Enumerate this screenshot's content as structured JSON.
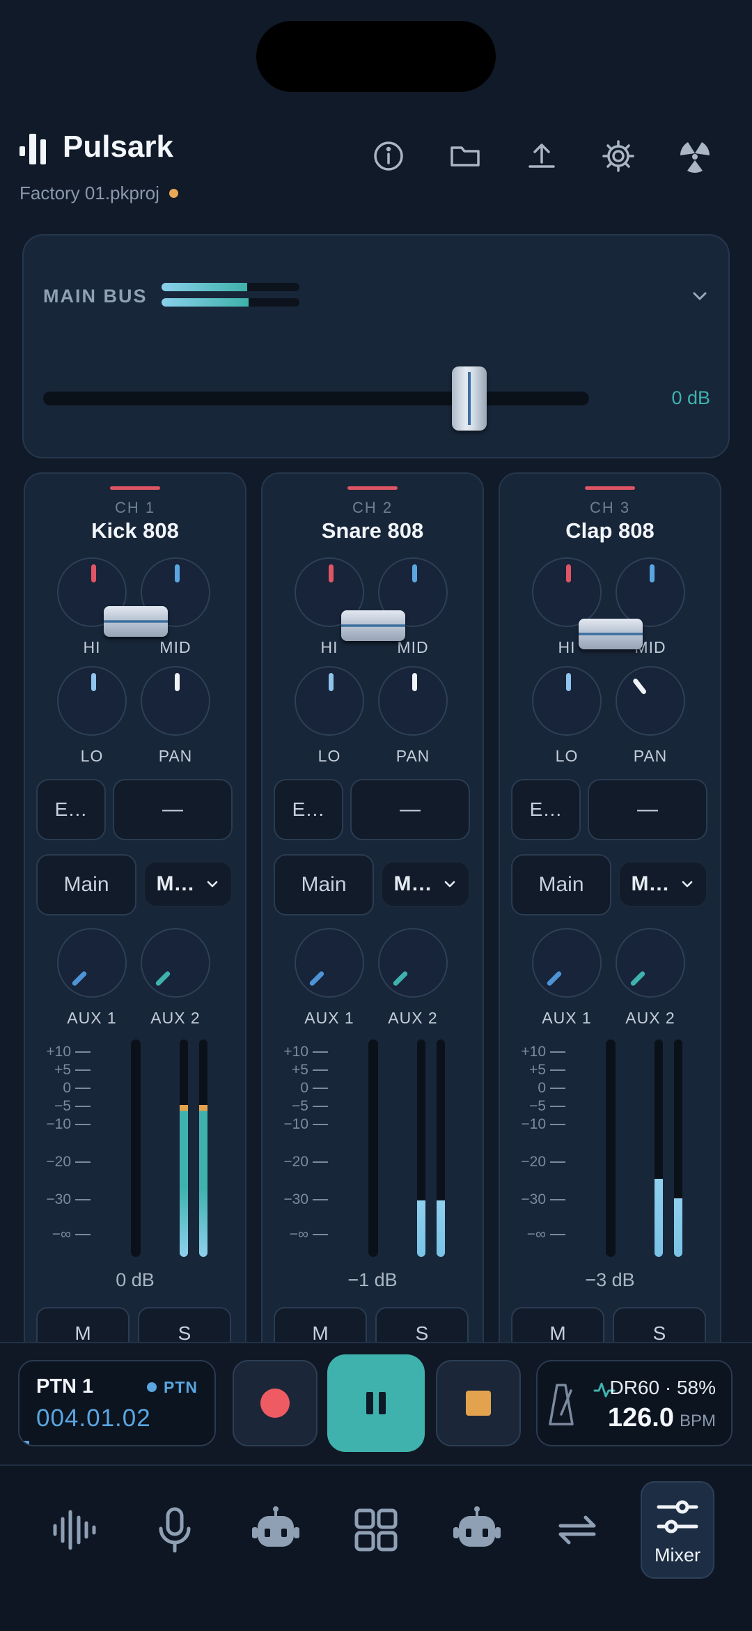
{
  "app": {
    "title": "Pulsark",
    "project": "Factory 01.pkproj"
  },
  "header_icons": [
    "info-icon",
    "folder-icon",
    "upload-icon",
    "gear-icon",
    "radiation-icon"
  ],
  "main_bus": {
    "label": "MAIN BUS",
    "level_l": 0.62,
    "level_r": 0.63,
    "fader_position": 0.78,
    "value": "0 dB"
  },
  "scale_labels": [
    "+10",
    "+5",
    "0",
    "−5",
    "−10",
    "−20",
    "−30",
    "−∞"
  ],
  "channels": [
    {
      "num": "CH 1",
      "name": "Kick 808",
      "knob_labels": [
        "HI",
        "MID",
        "LO",
        "PAN"
      ],
      "fx_button": "E…",
      "dash_button": "—",
      "route_button": "Main",
      "route_select": "M…",
      "aux_labels": [
        "AUX 1",
        "AUX 2"
      ],
      "fader_db": "0 dB",
      "mute": "M",
      "solo": "S",
      "meter_l": 0.7,
      "meter_r": 0.7
    },
    {
      "num": "CH 2",
      "name": "Snare 808",
      "knob_labels": [
        "HI",
        "MID",
        "LO",
        "PAN"
      ],
      "fx_button": "E…",
      "dash_button": "—",
      "route_button": "Main",
      "route_select": "M…",
      "aux_labels": [
        "AUX 1",
        "AUX 2"
      ],
      "fader_db": "−1 dB",
      "mute": "M",
      "solo": "S",
      "meter_l": 0.26,
      "meter_r": 0.26
    },
    {
      "num": "CH 3",
      "name": "Clap 808",
      "knob_labels": [
        "HI",
        "MID",
        "LO",
        "PAN"
      ],
      "fx_button": "E…",
      "dash_button": "—",
      "route_button": "Main",
      "route_select": "M…",
      "aux_labels": [
        "AUX 1",
        "AUX 2"
      ],
      "fader_db": "−3 dB",
      "mute": "M",
      "solo": "S",
      "meter_l": 0.36,
      "meter_r": 0.27
    }
  ],
  "transport": {
    "pattern": "PTN 1",
    "mode": "PTN",
    "position": "004.01.02",
    "progress": 0.05,
    "kit": "DR60 · 58%",
    "bpm": "126.0",
    "bpm_unit": "BPM"
  },
  "nav": {
    "active_label": "Mixer"
  },
  "colors": {
    "accent": "#3fb2ad",
    "blue": "#5aa6e0",
    "record": "#ef5b63",
    "stop": "#e3a34e",
    "eq_hi": "#e05563",
    "eq_mid": "#5aa6e0"
  }
}
